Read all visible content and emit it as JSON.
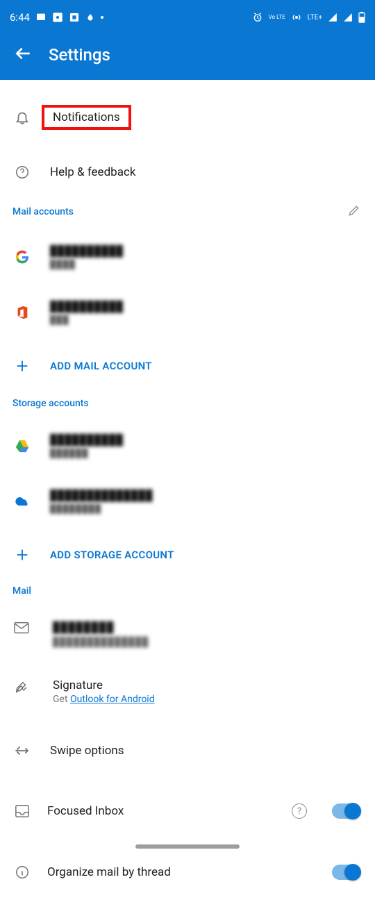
{
  "status": {
    "time": "6:44",
    "lte_text": "LTE+",
    "vo_text": "Vo LTE"
  },
  "app_bar": {
    "title": "Settings"
  },
  "top_items": {
    "notifications": "Notifications",
    "help": "Help & feedback"
  },
  "sections": {
    "mail_accounts": "Mail accounts",
    "storage_accounts": "Storage accounts",
    "mail": "Mail"
  },
  "mail_accounts": [
    {
      "iconColor": "google",
      "line1": "██████████",
      "line2": "████"
    },
    {
      "iconColor": "office",
      "line1": "██████████",
      "line2": "███"
    }
  ],
  "storage_accounts": [
    {
      "iconColor": "drive",
      "line1": "██████████",
      "line2": "██████"
    },
    {
      "iconColor": "onedrive",
      "line1": "██████████████",
      "line2": "████████"
    }
  ],
  "actions": {
    "add_mail": "ADD MAIL ACCOUNT",
    "add_storage": "ADD STORAGE ACCOUNT"
  },
  "mail_settings": {
    "default_l1": "████████",
    "default_l2": "██████████████",
    "signature": "Signature",
    "sig_sub_prefix": "Get ",
    "sig_sub_link": "Outlook for Android",
    "swipe": "Swipe options",
    "focused": "Focused Inbox",
    "thread": "Organize mail by thread"
  }
}
